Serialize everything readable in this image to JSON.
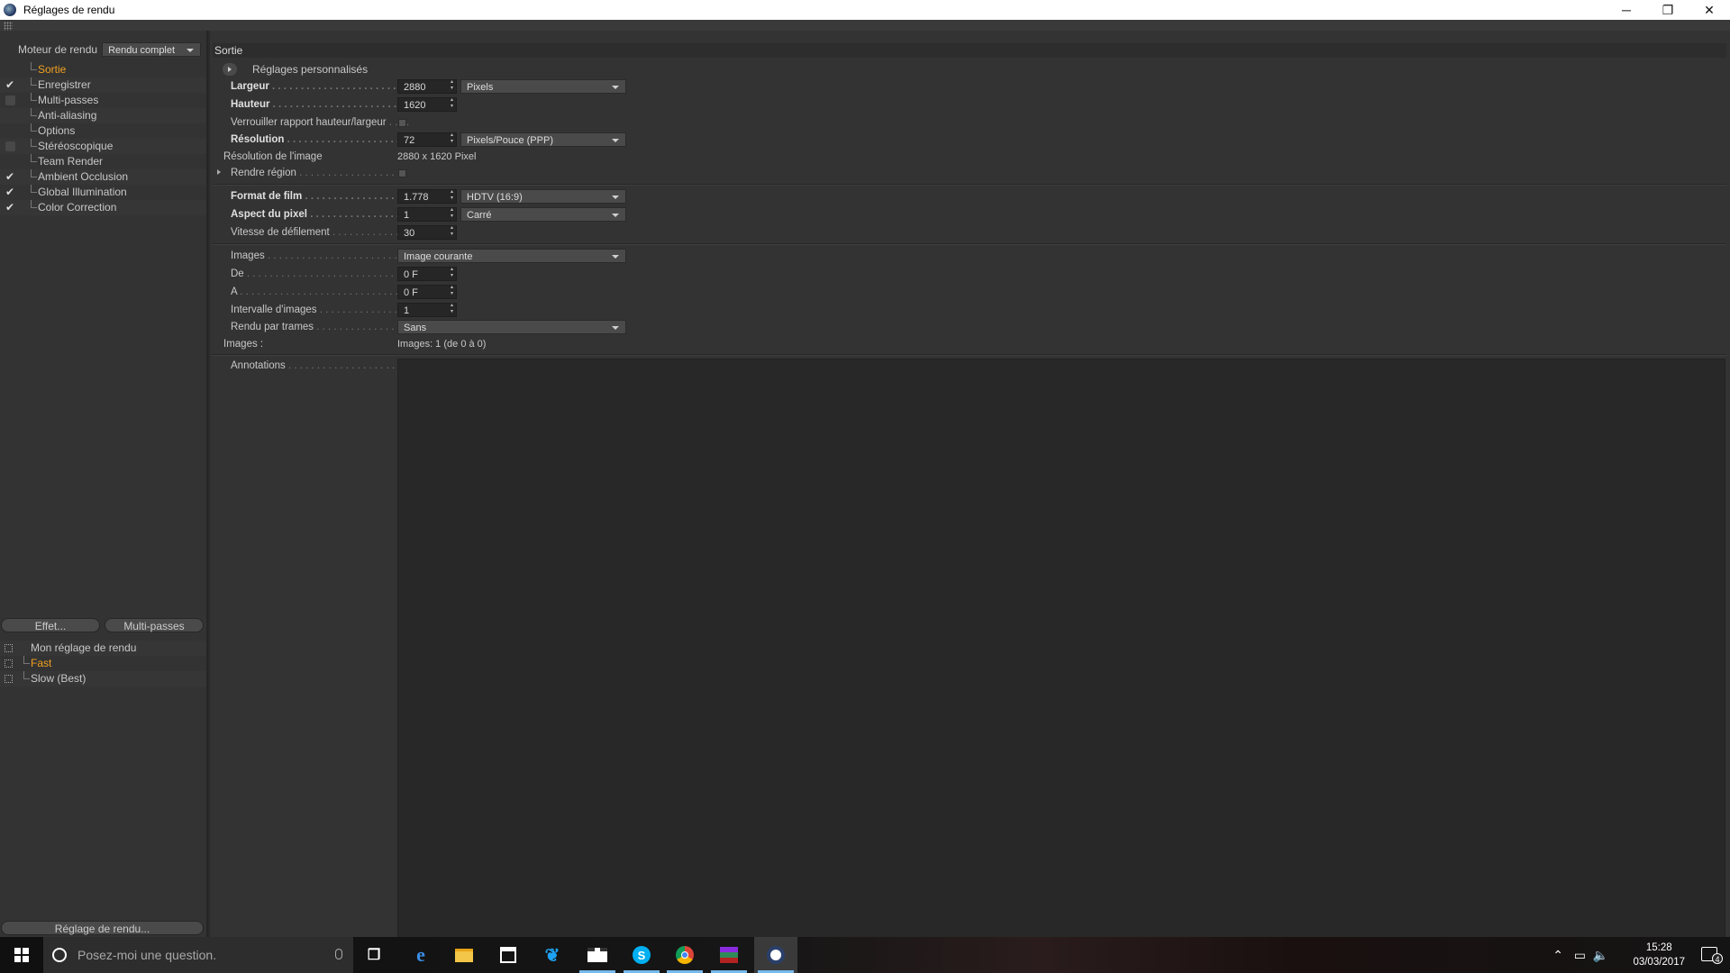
{
  "window": {
    "title": "Réglages de rendu",
    "controls": {
      "minimize": "─",
      "restore": "❐",
      "close": "✕"
    }
  },
  "left": {
    "engine_label": "Moteur de rendu",
    "engine_value": "Rendu complet",
    "tree": [
      {
        "label": "Sortie",
        "check": "none",
        "active": true
      },
      {
        "label": "Enregistrer",
        "check": "checked"
      },
      {
        "label": "Multi-passes",
        "check": "box"
      },
      {
        "label": "Anti-aliasing",
        "check": "none"
      },
      {
        "label": "Options",
        "check": "none"
      },
      {
        "label": "Stéréoscopique",
        "check": "box"
      },
      {
        "label": "Team Render",
        "check": "none"
      },
      {
        "label": "Ambient Occlusion",
        "check": "checked"
      },
      {
        "label": "Global Illumination",
        "check": "checked"
      },
      {
        "label": "Color Correction",
        "check": "checked"
      }
    ],
    "effect_button": "Effet...",
    "multipass_button": "Multi-passes",
    "presets": [
      {
        "label": "Mon réglage de rendu",
        "active": false
      },
      {
        "label": "Fast",
        "active": true
      },
      {
        "label": "Slow (Best)",
        "active": false
      }
    ],
    "render_setting_button": "Réglage de rendu..."
  },
  "right": {
    "section_title": "Sortie",
    "preset_title": "Réglages personnalisés",
    "width": {
      "label": "Largeur",
      "value": "2880",
      "unit": "Pixels"
    },
    "height": {
      "label": "Hauteur",
      "value": "1620"
    },
    "lock_ratio": {
      "label": "Verrouiller rapport hauteur/largeur",
      "checked": false
    },
    "resolution": {
      "label": "Résolution",
      "value": "72",
      "unit": "Pixels/Pouce (PPP)"
    },
    "image_resolution": {
      "label": "Résolution de l'image",
      "value": "2880 x 1620 Pixel"
    },
    "render_region": {
      "label": "Rendre région",
      "checked": false
    },
    "film_format": {
      "label": "Format de film",
      "value": "1.778",
      "preset": "HDTV (16:9)"
    },
    "pixel_aspect": {
      "label": "Aspect du pixel",
      "value": "1",
      "preset": "Carré"
    },
    "frame_rate": {
      "label": "Vitesse de défilement",
      "value": "30"
    },
    "frames": {
      "label": "Images",
      "value": "Image courante"
    },
    "from": {
      "label": "De",
      "value": "0 F"
    },
    "to": {
      "label": "A",
      "value": "0 F"
    },
    "frame_step": {
      "label": "Intervalle d'images",
      "value": "1"
    },
    "field_render": {
      "label": "Rendu par trames",
      "value": "Sans"
    },
    "frames_info": {
      "label": "Images :",
      "value": "Images: 1 (de 0 à 0)"
    },
    "annotations": {
      "label": "Annotations"
    }
  },
  "taskbar": {
    "search_placeholder": "Posez-moi une question.",
    "time": "15:28",
    "date": "03/03/2017",
    "notifications": "4",
    "icons": [
      "windows-icon",
      "task-view-icon",
      "edge-icon",
      "file-explorer-icon",
      "store-icon",
      "twitter-icon",
      "movies-icon",
      "skype-icon",
      "chrome-icon",
      "winrar-icon",
      "cinema4d-icon"
    ]
  }
}
